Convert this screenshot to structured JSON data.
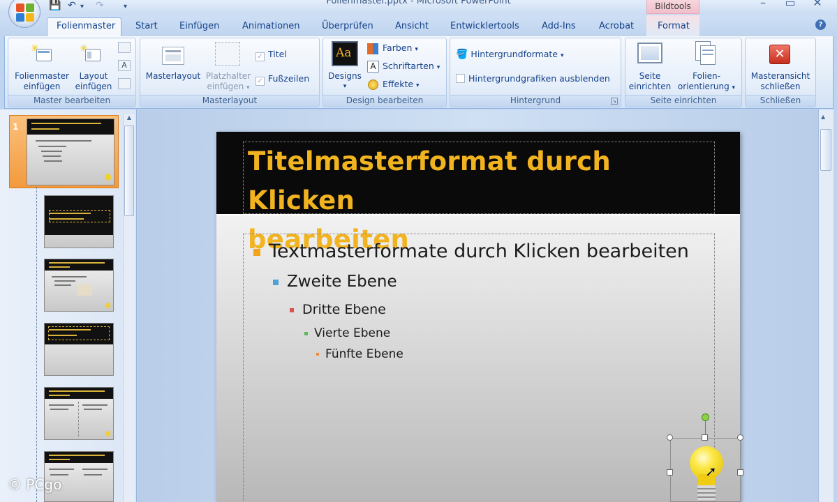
{
  "window": {
    "title": "Folienmaster.pptx - Microsoft PowerPoint",
    "contextual_tab_group": "Bildtools"
  },
  "tabs": [
    "Folienmaster",
    "Start",
    "Einfügen",
    "Animationen",
    "Überprüfen",
    "Ansicht",
    "Entwicklertools",
    "Add-Ins",
    "Acrobat",
    "Format"
  ],
  "ribbon": {
    "master_bearbeiten": {
      "label": "Master bearbeiten",
      "folienmaster_einfuegen": [
        "Folienmaster",
        "einfügen"
      ],
      "layout_einfuegen": [
        "Layout",
        "einfügen"
      ]
    },
    "masterlayout": {
      "label": "Masterlayout",
      "masterlayout_btn": "Masterlayout",
      "platzhalter_einfuegen": [
        "Platzhalter",
        "einfügen"
      ],
      "titel": "Titel",
      "fusszeilen": "Fußzeilen"
    },
    "design_bearbeiten": {
      "label": "Design bearbeiten",
      "designs": "Designs",
      "farben": "Farben",
      "schriftarten": "Schriftarten",
      "effekte": "Effekte"
    },
    "hintergrund": {
      "label": "Hintergrund",
      "hintergrundformate": "Hintergrundformate",
      "hintergrundgrafiken_ausblenden": "Hintergrundgrafiken ausblenden"
    },
    "seite_einrichten": {
      "label": "Seite einrichten",
      "seite_einrichten_btn": [
        "Seite",
        "einrichten"
      ],
      "folienorientierung": [
        "Folien-",
        "orientierung"
      ]
    },
    "schliessen": {
      "label": "Schließen",
      "masteransicht_schliessen": [
        "Masteransicht",
        "schließen"
      ]
    }
  },
  "thumbnails": {
    "first_number": "1"
  },
  "slide": {
    "title_lines": [
      "Titelmasterformat durch Klicken",
      "bearbeiten"
    ],
    "levels": [
      {
        "text": "Textmasterformate durch Klicken bearbeiten",
        "bullet_color": "#f2a31b"
      },
      {
        "text": "Zweite Ebene",
        "bullet_color": "#4ea3d6"
      },
      {
        "text": "Dritte Ebene",
        "bullet_color": "#d9534f"
      },
      {
        "text": "Vierte Ebene",
        "bullet_color": "#5cb85c"
      },
      {
        "text": "Fünfte Ebene",
        "bullet_color": "#f0893a"
      }
    ]
  },
  "watermark": "© PCgo",
  "colors": {
    "title_text": "#f2b320",
    "slide_header": "#0a0a0a",
    "accent_orange": "#f5a249"
  }
}
